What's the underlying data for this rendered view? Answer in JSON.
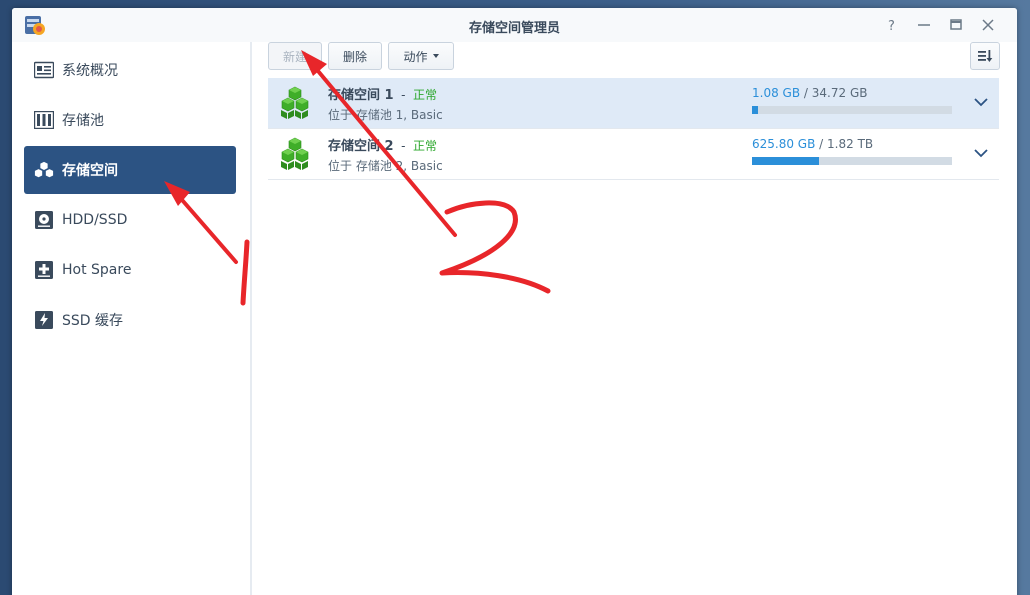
{
  "window": {
    "title": "存储空间管理员"
  },
  "sidebar": {
    "items": [
      {
        "label": "系统概况",
        "icon": "overview-icon",
        "active": false
      },
      {
        "label": "存储池",
        "icon": "storage-pool-icon",
        "active": false
      },
      {
        "label": "存储空间",
        "icon": "volume-icon",
        "active": true
      },
      {
        "label": "HDD/SSD",
        "icon": "disk-icon",
        "active": false
      },
      {
        "label": "Hot Spare",
        "icon": "hot-spare-icon",
        "active": false
      },
      {
        "label": "SSD 缓存",
        "icon": "ssd-cache-icon",
        "active": false
      }
    ]
  },
  "toolbar": {
    "create_label": "新建",
    "delete_label": "删除",
    "action_label": "动作"
  },
  "volumes": [
    {
      "name": "存储空间 1",
      "dash": "-",
      "status": "正常",
      "location": "位于 存储池 1, Basic",
      "used": "1.08 GB",
      "sep": "/",
      "total": "34.72 GB",
      "usage_fraction": 0.031,
      "selected": true
    },
    {
      "name": "存储空间 2",
      "dash": "-",
      "status": "正常",
      "location": "位于 存储池 2, Basic",
      "used": "625.80 GB",
      "sep": "/",
      "total": "1.82 TB",
      "usage_fraction": 0.336,
      "selected": false
    }
  ],
  "annotations": {
    "label_1": "1",
    "label_2": "2",
    "color": "#e8262a"
  },
  "colors": {
    "accent": "#2c5383",
    "status_ok": "#2ea82e",
    "usage_blue": "#2b8fd9"
  }
}
